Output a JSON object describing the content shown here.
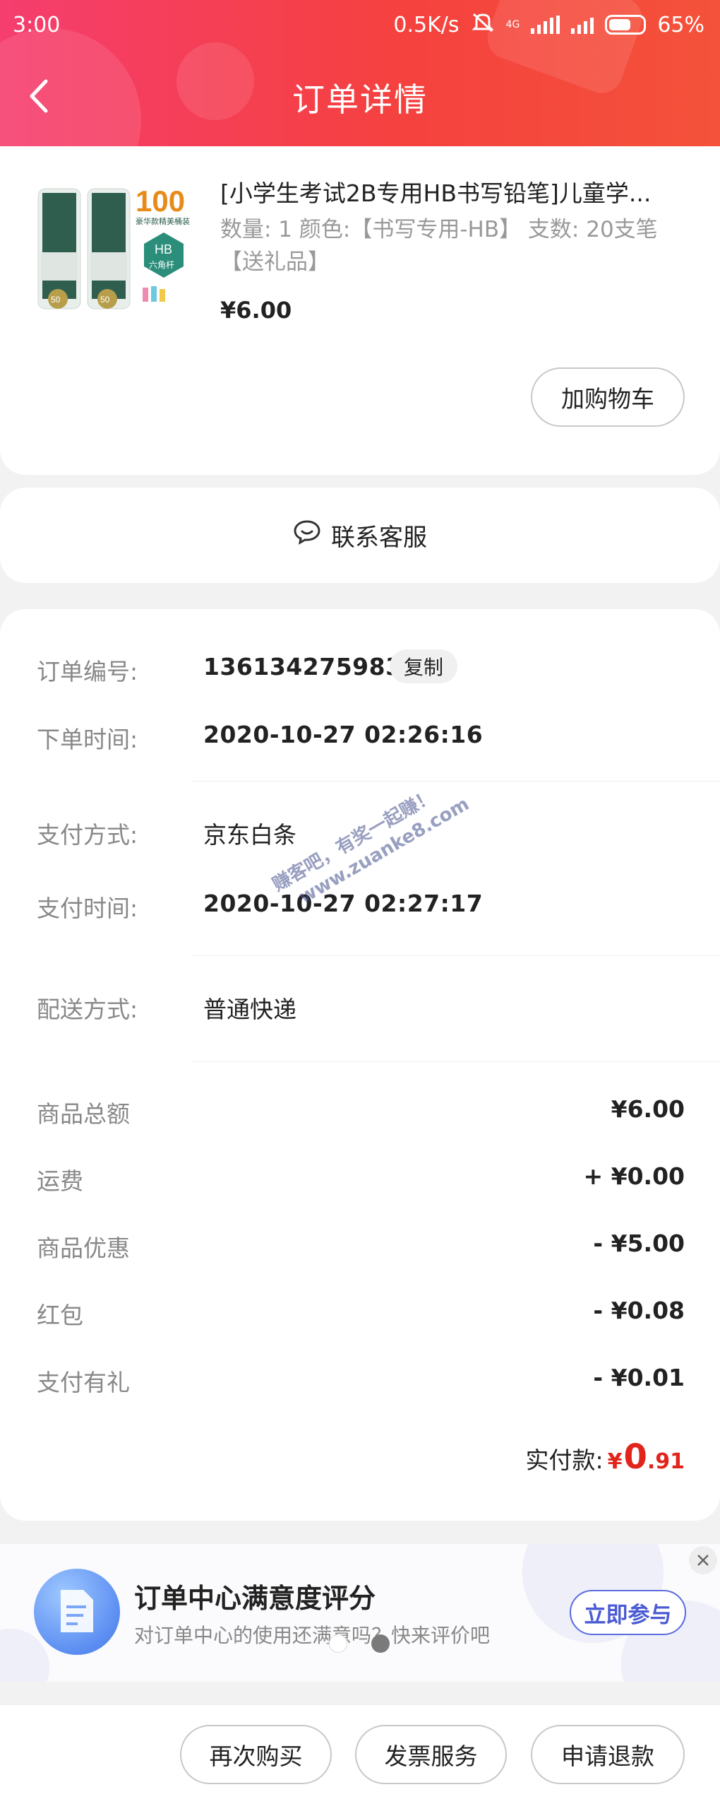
{
  "status_bar": {
    "time": "3:00",
    "net_speed": "0.5K/s",
    "network": "4G",
    "battery": "65%"
  },
  "header": {
    "title": "订单详情"
  },
  "product": {
    "title": "[小学生考试2B专用HB书写铅笔]儿童学...",
    "spec": "数量: 1  颜色:【书写专用-HB】 支数: 20支笔【送礼品】",
    "price": "¥6.00",
    "image": {
      "badge": "100",
      "badge_sub": "豪华款精美桶装",
      "hex_label": "HB",
      "hex_sub": "六角杆",
      "count": "50"
    },
    "add_cart_label": "加购物车"
  },
  "contact": {
    "label": "联系客服"
  },
  "order_info": {
    "order_no_label": "订单编号:",
    "order_no": "136134275983",
    "copy_label": "复制",
    "order_time_label": "下单时间:",
    "order_time": "2020-10-27 02:26:16",
    "pay_method_label": "支付方式:",
    "pay_method": "京东白条",
    "pay_time_label": "支付时间:",
    "pay_time": "2020-10-27 02:27:17",
    "delivery_label": "配送方式:",
    "delivery": "普通快递"
  },
  "amounts": [
    {
      "label": "商品总额",
      "value": "¥6.00"
    },
    {
      "label": "运费",
      "value": "+ ¥0.00"
    },
    {
      "label": "商品优惠",
      "value": "- ¥5.00"
    },
    {
      "label": "红包",
      "value": "- ¥0.08"
    },
    {
      "label": "支付有礼",
      "value": "- ¥0.01"
    }
  ],
  "paid": {
    "label": "实付款:",
    "currency": "¥",
    "integer": "0",
    "decimal": ".91"
  },
  "survey": {
    "title": "订单中心满意度评分",
    "subtitle": "对订单中心的使用还满意吗？快来评价吧",
    "button": "立即参与"
  },
  "bottom_actions": {
    "rebuy": "再次购买",
    "invoice": "发票服务",
    "refund": "申请退款"
  },
  "watermark": {
    "line1": "赚客吧，有奖一起赚！",
    "line2": "www.zuanke8.com"
  },
  "colors": {
    "header_start": "#f53d6f",
    "header_end": "#f4523a",
    "price_red": "#e1251b",
    "survey_blue": "#5a6bde"
  }
}
